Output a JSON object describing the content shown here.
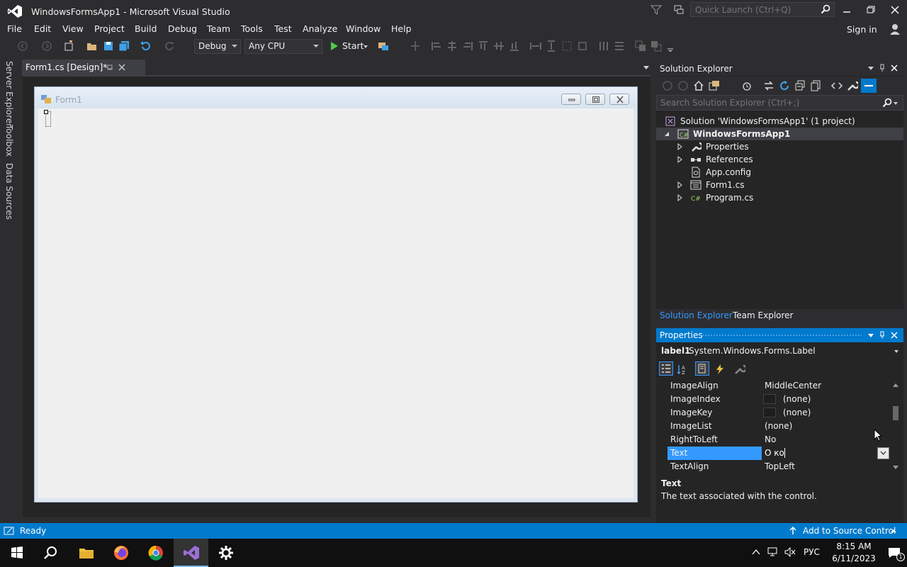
{
  "window": {
    "title": "WindowsFormsApp1 - Microsoft Visual Studio",
    "quick_launch_placeholder": "Quick Launch (Ctrl+Q)"
  },
  "menu": [
    "File",
    "Edit",
    "View",
    "Project",
    "Build",
    "Debug",
    "Team",
    "Tools",
    "Test",
    "Analyze",
    "Window",
    "Help"
  ],
  "sign_in": "Sign in",
  "toolbar": {
    "configuration": "Debug",
    "platform": "Any CPU",
    "start_label": "Start"
  },
  "side_tabs": [
    "Server Explorer",
    "Toolbox",
    "Data Sources"
  ],
  "document_tab": {
    "label": "Form1.cs [Design]*"
  },
  "form": {
    "title": "Form1"
  },
  "solution_explorer": {
    "title": "Solution Explorer",
    "search_placeholder": "Search Solution Explorer (Ctrl+;)",
    "tree": [
      {
        "label": "Solution 'WindowsFormsApp1' (1 project)",
        "icon": "solution-icon",
        "level": 0,
        "expander": "none"
      },
      {
        "label": "WindowsFormsApp1",
        "icon": "csharp-project-icon",
        "level": 1,
        "expander": "expanded",
        "bold": true
      },
      {
        "label": "Properties",
        "icon": "wrench-icon",
        "level": 2,
        "expander": "collapsed"
      },
      {
        "label": "References",
        "icon": "references-icon",
        "level": 2,
        "expander": "collapsed"
      },
      {
        "label": "App.config",
        "icon": "config-file-icon",
        "level": 2,
        "expander": "none"
      },
      {
        "label": "Form1.cs",
        "icon": "form-file-icon",
        "level": 2,
        "expander": "collapsed"
      },
      {
        "label": "Program.cs",
        "icon": "csharp-file-icon",
        "level": 2,
        "expander": "collapsed"
      }
    ],
    "bottom_tabs": [
      "Solution Explorer",
      "Team Explorer"
    ]
  },
  "properties": {
    "title": "Properties",
    "object_name": "label1",
    "object_type": "System.Windows.Forms.Label",
    "rows": [
      {
        "name": "ImageAlign",
        "value": "MiddleCenter",
        "swatch": false
      },
      {
        "name": "ImageIndex",
        "value": "(none)",
        "swatch": true
      },
      {
        "name": "ImageKey",
        "value": "(none)",
        "swatch": true
      },
      {
        "name": "ImageList",
        "value": "(none)",
        "swatch": false
      },
      {
        "name": "RightToLeft",
        "value": "No",
        "swatch": false
      },
      {
        "name": "Text",
        "value": "О ко",
        "swatch": false,
        "selected": true
      },
      {
        "name": "TextAlign",
        "value": "TopLeft",
        "swatch": false
      }
    ],
    "description_title": "Text",
    "description_text": "The text associated with the control."
  },
  "statusbar": {
    "status": "Ready",
    "source_control": "Add to Source Control"
  },
  "taskbar": {
    "lang": "РУС",
    "time": "8:15 AM",
    "date": "6/11/2023",
    "notification_count": "1"
  },
  "colors": {
    "accent": "#007acc",
    "background": "#2d2d30",
    "selection": "#3399ff"
  }
}
